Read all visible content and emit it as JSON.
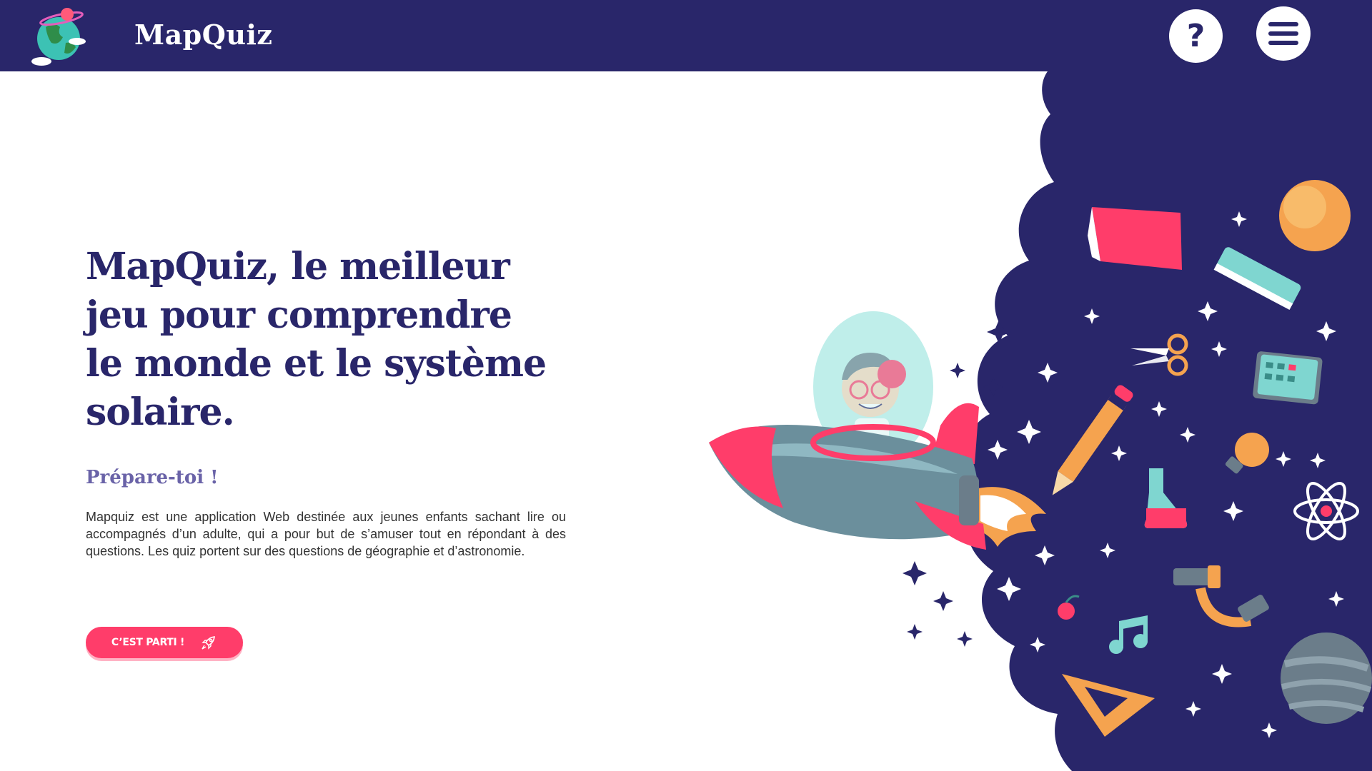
{
  "header": {
    "brand": "MapQuiz",
    "help_label": "?",
    "logo_icon": "globe-with-planet-icon",
    "help_icon": "question-icon",
    "menu_icon": "hamburger-menu-icon"
  },
  "hero": {
    "title": "MapQuiz, le meilleur jeu pour comprendre le monde et le système solaire.",
    "subtitle": "Prépare-toi !",
    "description": "Mapquiz est une application Web destinée aux jeunes enfants sachant lire ou accompagnés d’un adulte, qui a pour but de s’amuser tout en répondant à des questions. Les quiz portent sur des questions de géographie et d’astronomie.",
    "cta_label": "C’EST PARTI !",
    "cta_icon": "rocket-icon"
  },
  "illustration": {
    "name": "child-in-rocket-illustration",
    "items": [
      "book",
      "orange-planet",
      "teal-book",
      "scissors",
      "calculator",
      "pencil",
      "lightbulb",
      "flask",
      "atom",
      "microscope",
      "cherry",
      "music-note",
      "set-square",
      "grey-planet",
      "stars"
    ]
  },
  "colors": {
    "navy": "#29266a",
    "accent": "#ff3d6a",
    "subtitle": "#6a63a8",
    "white": "#ffffff"
  }
}
